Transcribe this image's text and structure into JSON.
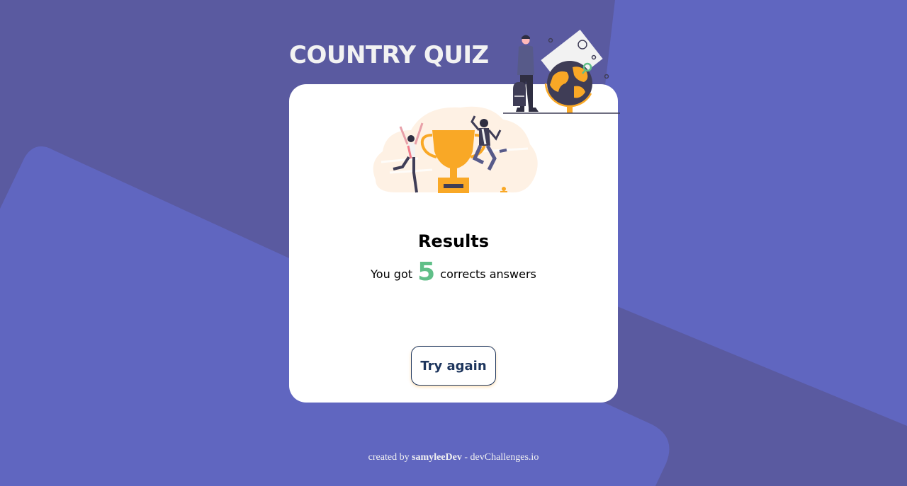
{
  "app": {
    "title": "COUNTRY QUIZ"
  },
  "results": {
    "heading": "Results",
    "prefix": "You got",
    "score": "5",
    "suffix": "corrects answers"
  },
  "actions": {
    "try_again_label": "Try again"
  },
  "footer": {
    "created_by": "created by",
    "author": "samyleeDev",
    "separator": "-",
    "site": "devChallenges.io"
  },
  "icons": {
    "header_illustration": "adventure-globe-illustration",
    "results_illustration": "winners-trophy-illustration"
  },
  "colors": {
    "background": "#5A5AA0",
    "background_shape": "#6066C0",
    "title": "#F2F2F2",
    "card": "#FFFFFF",
    "score": "#60BF88",
    "button_text": "#1D355D",
    "trophy": "#F9A826"
  }
}
